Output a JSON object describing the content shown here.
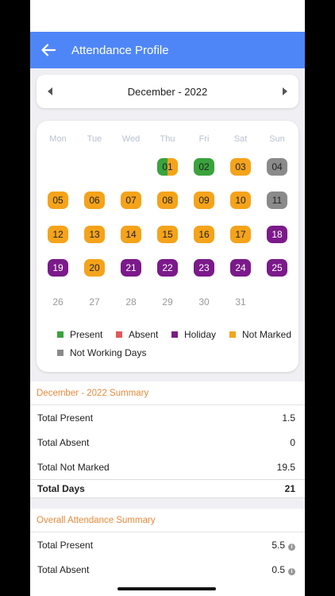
{
  "app_bar": {
    "title": "Attendance Profile"
  },
  "month_nav": {
    "label": "December - 2022"
  },
  "calendar": {
    "weekdays": [
      "Mon",
      "Tue",
      "Wed",
      "Thu",
      "Fri",
      "Sat",
      "Sun"
    ],
    "days": [
      {
        "d": "01",
        "s": "split"
      },
      {
        "d": "02",
        "s": "present"
      },
      {
        "d": "03",
        "s": "notmarked"
      },
      {
        "d": "04",
        "s": "nonworking"
      },
      {
        "d": "05",
        "s": "notmarked"
      },
      {
        "d": "06",
        "s": "notmarked"
      },
      {
        "d": "07",
        "s": "notmarked"
      },
      {
        "d": "08",
        "s": "notmarked"
      },
      {
        "d": "09",
        "s": "notmarked"
      },
      {
        "d": "10",
        "s": "notmarked"
      },
      {
        "d": "11",
        "s": "nonworking"
      },
      {
        "d": "12",
        "s": "notmarked"
      },
      {
        "d": "13",
        "s": "notmarked"
      },
      {
        "d": "14",
        "s": "notmarked"
      },
      {
        "d": "15",
        "s": "notmarked"
      },
      {
        "d": "16",
        "s": "notmarked"
      },
      {
        "d": "17",
        "s": "notmarked"
      },
      {
        "d": "18",
        "s": "holiday"
      },
      {
        "d": "19",
        "s": "holiday"
      },
      {
        "d": "20",
        "s": "notmarked"
      },
      {
        "d": "21",
        "s": "holiday"
      },
      {
        "d": "22",
        "s": "holiday"
      },
      {
        "d": "23",
        "s": "holiday"
      },
      {
        "d": "24",
        "s": "holiday"
      },
      {
        "d": "25",
        "s": "holiday"
      },
      {
        "d": "26",
        "s": "future"
      },
      {
        "d": "27",
        "s": "future"
      },
      {
        "d": "28",
        "s": "future"
      },
      {
        "d": "29",
        "s": "future"
      },
      {
        "d": "30",
        "s": "future"
      },
      {
        "d": "31",
        "s": "future"
      }
    ],
    "first_weekday_index": 3
  },
  "legend": {
    "present": "Present",
    "absent": "Absent",
    "holiday": "Holiday",
    "not_marked": "Not Marked",
    "not_working": "Not Working Days"
  },
  "colors": {
    "app_bar": "#4f86f7",
    "present": "#3aa33c",
    "absent": "#e05a5a",
    "holiday": "#7b1a8a",
    "not_marked": "#f5a31a",
    "not_working": "#8a8a8a",
    "section_header": "#e8893a"
  },
  "month_summary": {
    "title": "December - 2022 Summary",
    "present_label": "Total Present",
    "present_value": "1.5",
    "absent_label": "Total Absent",
    "absent_value": "0",
    "not_marked_label": "Total Not Marked",
    "not_marked_value": "19.5",
    "total_label": "Total Days",
    "total_value": "21"
  },
  "overall_summary": {
    "title": "Overall Attendance Summary",
    "present_label": "Total Present",
    "present_value": "5.5",
    "absent_label": "Total Absent",
    "absent_value": "0.5"
  }
}
